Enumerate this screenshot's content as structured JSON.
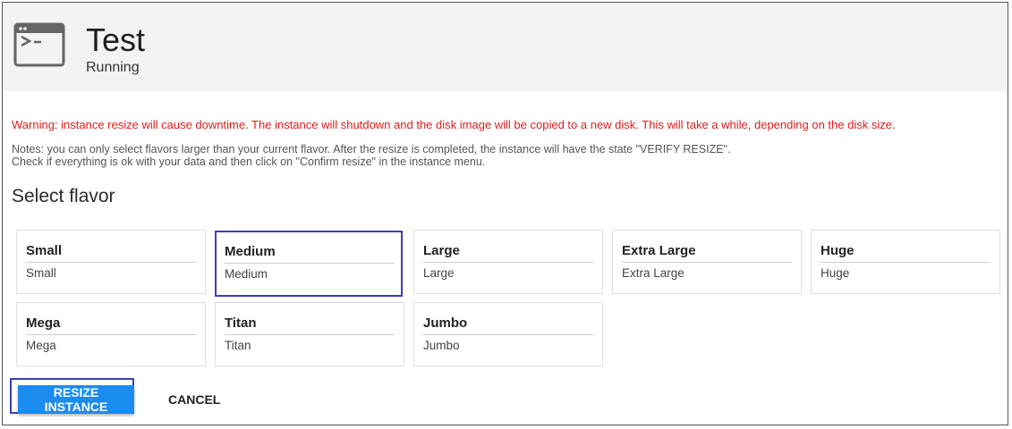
{
  "instance": {
    "name": "Test",
    "status": "Running"
  },
  "warning": "Warning: instance resize will cause downtime. The instance will shutdown and the disk image will be copied to a new disk. This will take a while, depending on the disk size.",
  "notes": {
    "line1": "Notes: you can only select flavors larger than your current flavor. After the resize is completed, the instance will have the state \"VERIFY RESIZE\".",
    "line2": "Check if everything is ok with your data and then click on \"Confirm resize\" in the instance menu."
  },
  "section_title": "Select flavor",
  "flavors": [
    {
      "name": "Small",
      "description": "Small"
    },
    {
      "name": "Medium",
      "description": "Medium"
    },
    {
      "name": "Large",
      "description": "Large"
    },
    {
      "name": "Extra Large",
      "description": "Extra Large"
    },
    {
      "name": "Huge",
      "description": "Huge"
    },
    {
      "name": "Mega",
      "description": "Mega"
    },
    {
      "name": "Titan",
      "description": "Titan"
    },
    {
      "name": "Jumbo",
      "description": "Jumbo"
    }
  ],
  "selected_flavor": "Medium",
  "buttons": {
    "resize": "RESIZE INSTANCE",
    "cancel": "CANCEL"
  },
  "colors": {
    "warning": "#e01b1b",
    "primary": "#1a8cf0",
    "focus": "#3b3fb6"
  },
  "icons": {
    "instance": "terminal-window-icon"
  }
}
